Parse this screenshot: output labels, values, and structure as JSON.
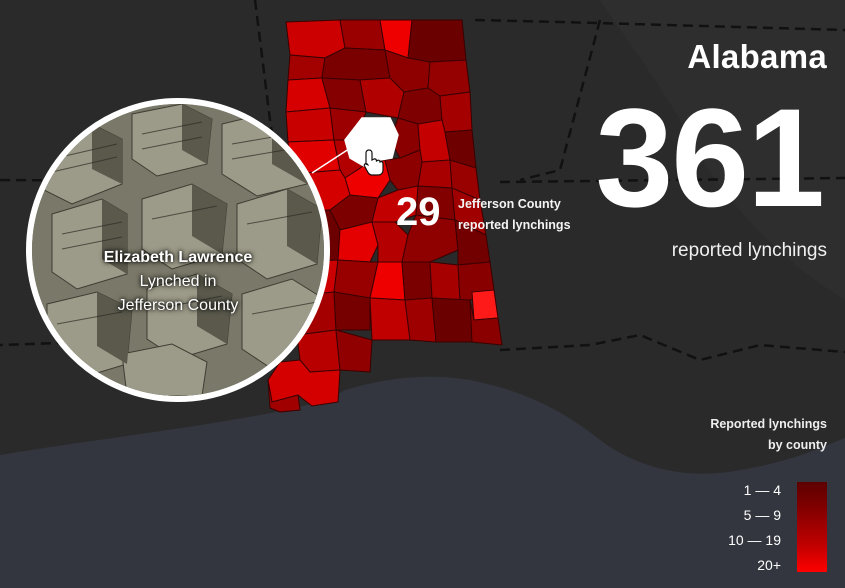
{
  "state": {
    "name": "Alabama",
    "total": "361",
    "total_label": "reported lynchings"
  },
  "county": {
    "count": "29",
    "name_line": "Jefferson County",
    "label_line": "reported lynchings"
  },
  "victim": {
    "name": "Elizabeth Lawrence",
    "line1": "Lynched in",
    "line2": "Jefferson County"
  },
  "legend": {
    "title_line1": "Reported lynchings",
    "title_line2": "by county",
    "bins": [
      "1 — 4",
      "5 — 9",
      "10 — 19",
      "20+"
    ],
    "colors": [
      "#5c0000",
      "#8a0000",
      "#c00000",
      "#ff0000"
    ]
  },
  "colors": {
    "background": "#2a2a2a",
    "sea": "#33363f",
    "highlight": "#ffffff"
  },
  "icons": {
    "pointer": "hand-pointer-icon"
  }
}
